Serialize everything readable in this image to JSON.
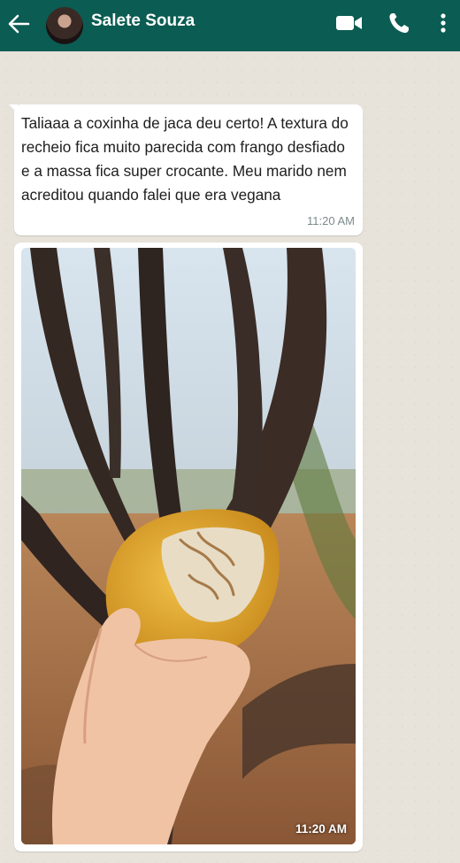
{
  "header": {
    "contact_name": "Salete Souza",
    "back_icon": "arrow-left-icon",
    "video_icon": "video-call-icon",
    "call_icon": "phone-icon",
    "menu_icon": "more-vert-icon",
    "color": "#0b5c52"
  },
  "messages": [
    {
      "type": "text",
      "text": "Taliaaa a coxinha de jaca deu certo! A textura do recheio fica muito parecida com frango desfiado e a massa fica super crocante. Meu marido nem acreditou quando falei que era vegana",
      "time": "11:20 AM"
    },
    {
      "type": "image",
      "time": "11:20 AM"
    }
  ]
}
